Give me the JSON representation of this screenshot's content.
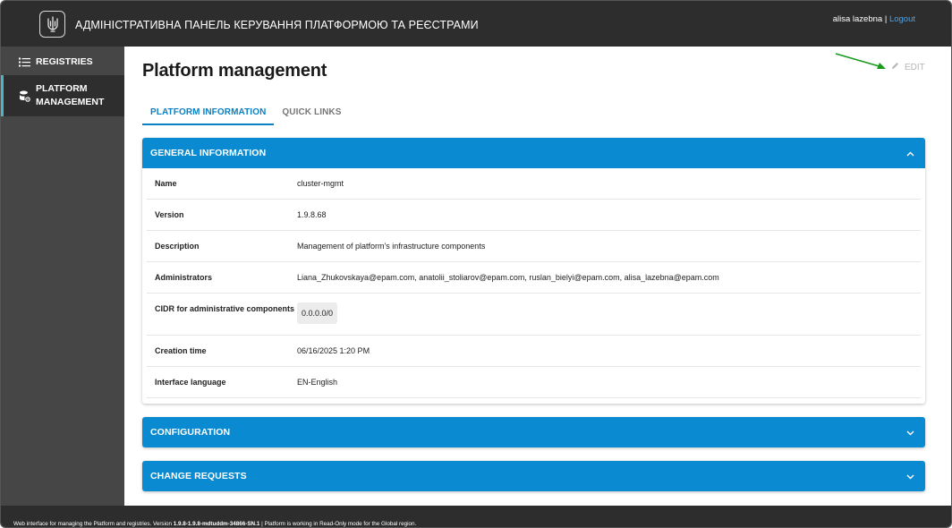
{
  "header": {
    "title": "АДМІНІСТРАТИВНА ПАНЕЛЬ КЕРУВАННЯ ПЛАТФОРМОЮ ТА РЕЄСТРАМИ",
    "user": "alisa lazebna",
    "separator": " | ",
    "logout": "Logout"
  },
  "sidebar": {
    "items": [
      {
        "label": "REGISTRIES",
        "icon": "list-icon"
      },
      {
        "label": "PLATFORM\nMANAGEMENT",
        "icon": "database-settings-icon",
        "active": true
      }
    ]
  },
  "main": {
    "title": "Platform management",
    "edit_label": "EDIT",
    "tabs": [
      {
        "label": "PLATFORM INFORMATION",
        "active": true
      },
      {
        "label": "QUICK LINKS",
        "active": false
      }
    ],
    "panels": {
      "general": {
        "title": "GENERAL INFORMATION",
        "rows": [
          {
            "key": "Name",
            "value": "cluster-mgmt"
          },
          {
            "key": "Version",
            "value": "1.9.8.68"
          },
          {
            "key": "Description",
            "value": "Management of platform's infrastructure components"
          },
          {
            "key": "Administrators",
            "value": "Liana_Zhukovskaya@epam.com, anatolii_stoliarov@epam.com, ruslan_bielyi@epam.com, alisa_lazebna@epam.com"
          },
          {
            "key": "CIDR for administrative components",
            "value": "0.0.0.0/0"
          },
          {
            "key": "Creation time",
            "value": "06/16/2025 1:20 PM"
          },
          {
            "key": "Interface language",
            "value": "EN-English"
          }
        ]
      },
      "configuration": {
        "title": "CONFIGURATION"
      },
      "change_requests": {
        "title": "CHANGE REQUESTS"
      }
    }
  },
  "footer": {
    "prefix": "Web interface for managing the Platform and registries. Version ",
    "version": "1.9.8-1.9.8-mdtuddm-34866-SN.1",
    "suffix": " | Platform is working in Read-Only mode for the Global region."
  },
  "colors": {
    "accent": "#0a8ad0",
    "header_bg": "#2d2d2d",
    "sidebar_bg": "#464646",
    "annotation_arrow": "#1a9a1a"
  }
}
